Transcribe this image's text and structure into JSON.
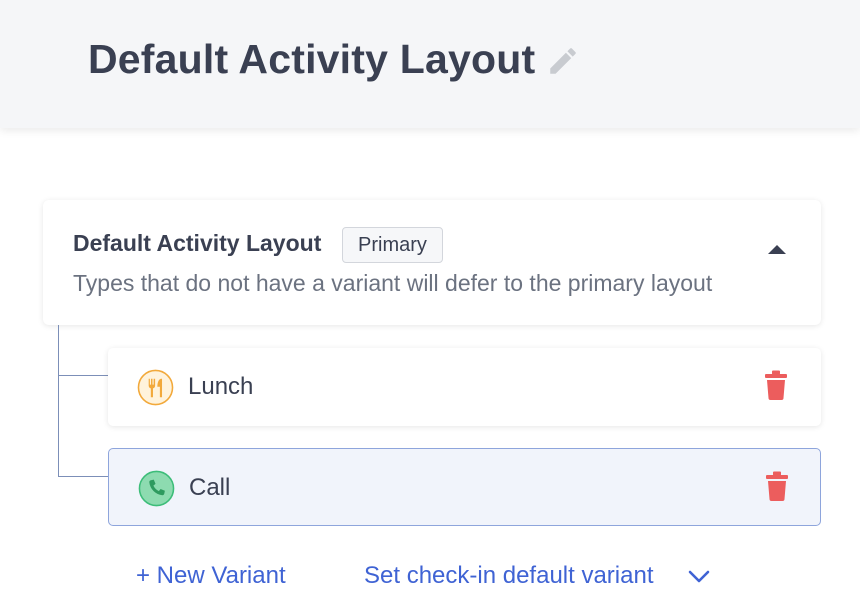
{
  "header": {
    "title": "Default Activity Layout"
  },
  "layout_card": {
    "title": "Default Activity Layout",
    "badge": "Primary",
    "description": "Types that do not have a variant will defer to the primary layout"
  },
  "variants": [
    {
      "label": "Lunch",
      "icon": "utensils-icon",
      "color": "#f2a93b"
    },
    {
      "label": "Call",
      "icon": "phone-icon",
      "color": "#3dbd79"
    }
  ],
  "actions": {
    "new_variant": "+ New Variant",
    "checkin_default": "Set check-in default variant"
  },
  "colors": {
    "accent": "#3f63d4",
    "danger": "#ec5d5d",
    "text": "#3a4052"
  }
}
